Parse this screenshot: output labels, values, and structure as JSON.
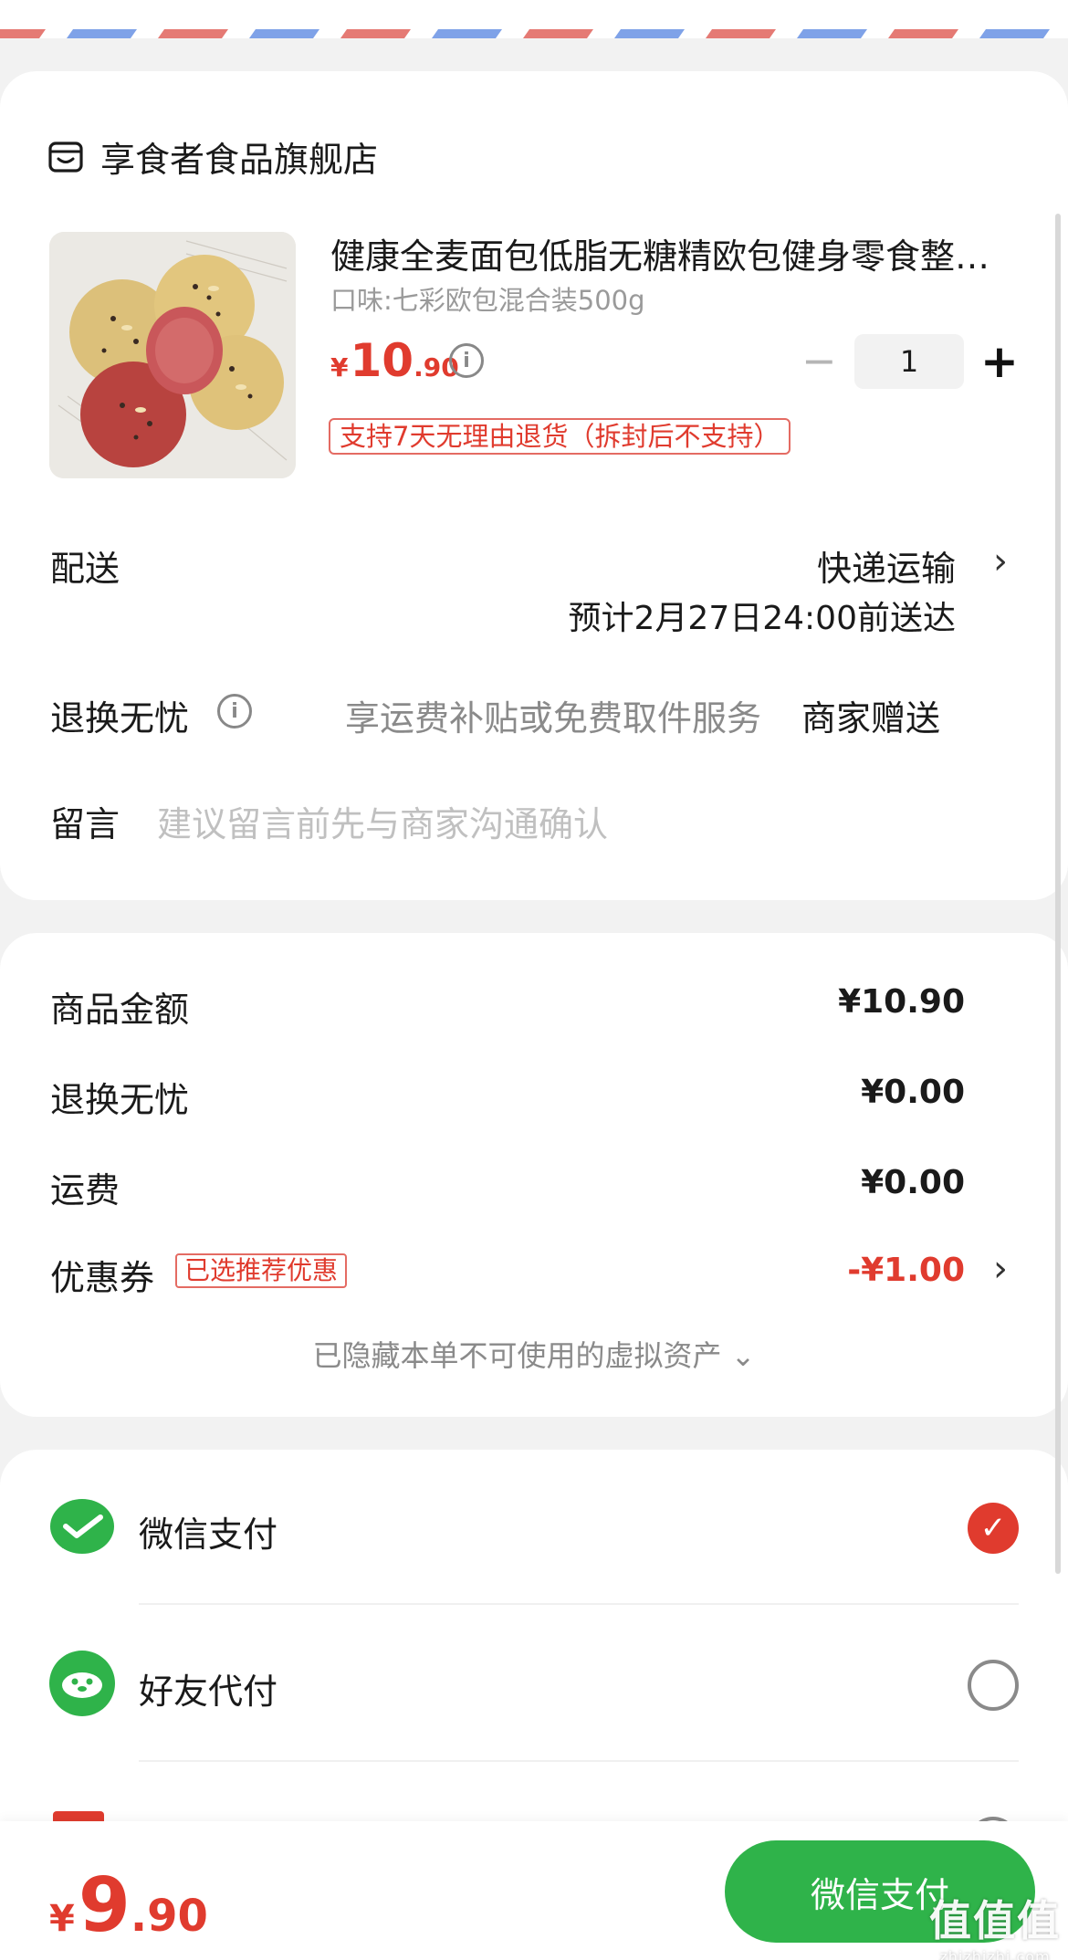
{
  "shop": {
    "name": "享食者食品旗舰店",
    "icon": "shop-icon"
  },
  "product": {
    "title": "健康全麦面包低脂无糖精欧包健身零食整…",
    "spec": "口味:七彩欧包混合装500g",
    "price": {
      "symbol": "¥",
      "integer": "10",
      "decimal": ".90"
    },
    "quantity": "1",
    "minus": "−",
    "plus": "+",
    "return_policy": "支持7天无理由退货（拆封后不支持）"
  },
  "delivery": {
    "label": "配送",
    "method": "快递运输",
    "eta": "预计2月27日24:00前送达"
  },
  "worry_free": {
    "label": "退换无忧",
    "desc": "享运费补贴或免费取件服务",
    "provider": "商家赠送"
  },
  "message": {
    "label": "留言",
    "placeholder": "建议留言前先与商家沟通确认"
  },
  "summary": {
    "rows": [
      {
        "label": "商品金额",
        "value": "¥10.90"
      },
      {
        "label": "退换无忧",
        "value": "¥0.00"
      },
      {
        "label": "运费",
        "value": "¥0.00"
      },
      {
        "label": "优惠券",
        "value": "-¥1.00"
      }
    ],
    "coupon_tag": "已选推荐优惠",
    "hidden_note": "已隐藏本单不可使用的虚拟资产 ⌄"
  },
  "payment": {
    "options": [
      {
        "label": "微信支付",
        "icon": "wechat-pay-icon",
        "selected": true
      },
      {
        "label": "好友代付",
        "icon": "friend-pay-icon",
        "selected": false
      }
    ]
  },
  "footer": {
    "total": {
      "symbol": "¥",
      "integer": "9",
      "decimal": ".90"
    },
    "pay_button": "微信支付"
  },
  "watermark": {
    "main": "值值值",
    "sub": "zhizhizhi.com"
  },
  "colors": {
    "accent_red": "#e03b2e",
    "wechat_green": "#2fb34a"
  }
}
